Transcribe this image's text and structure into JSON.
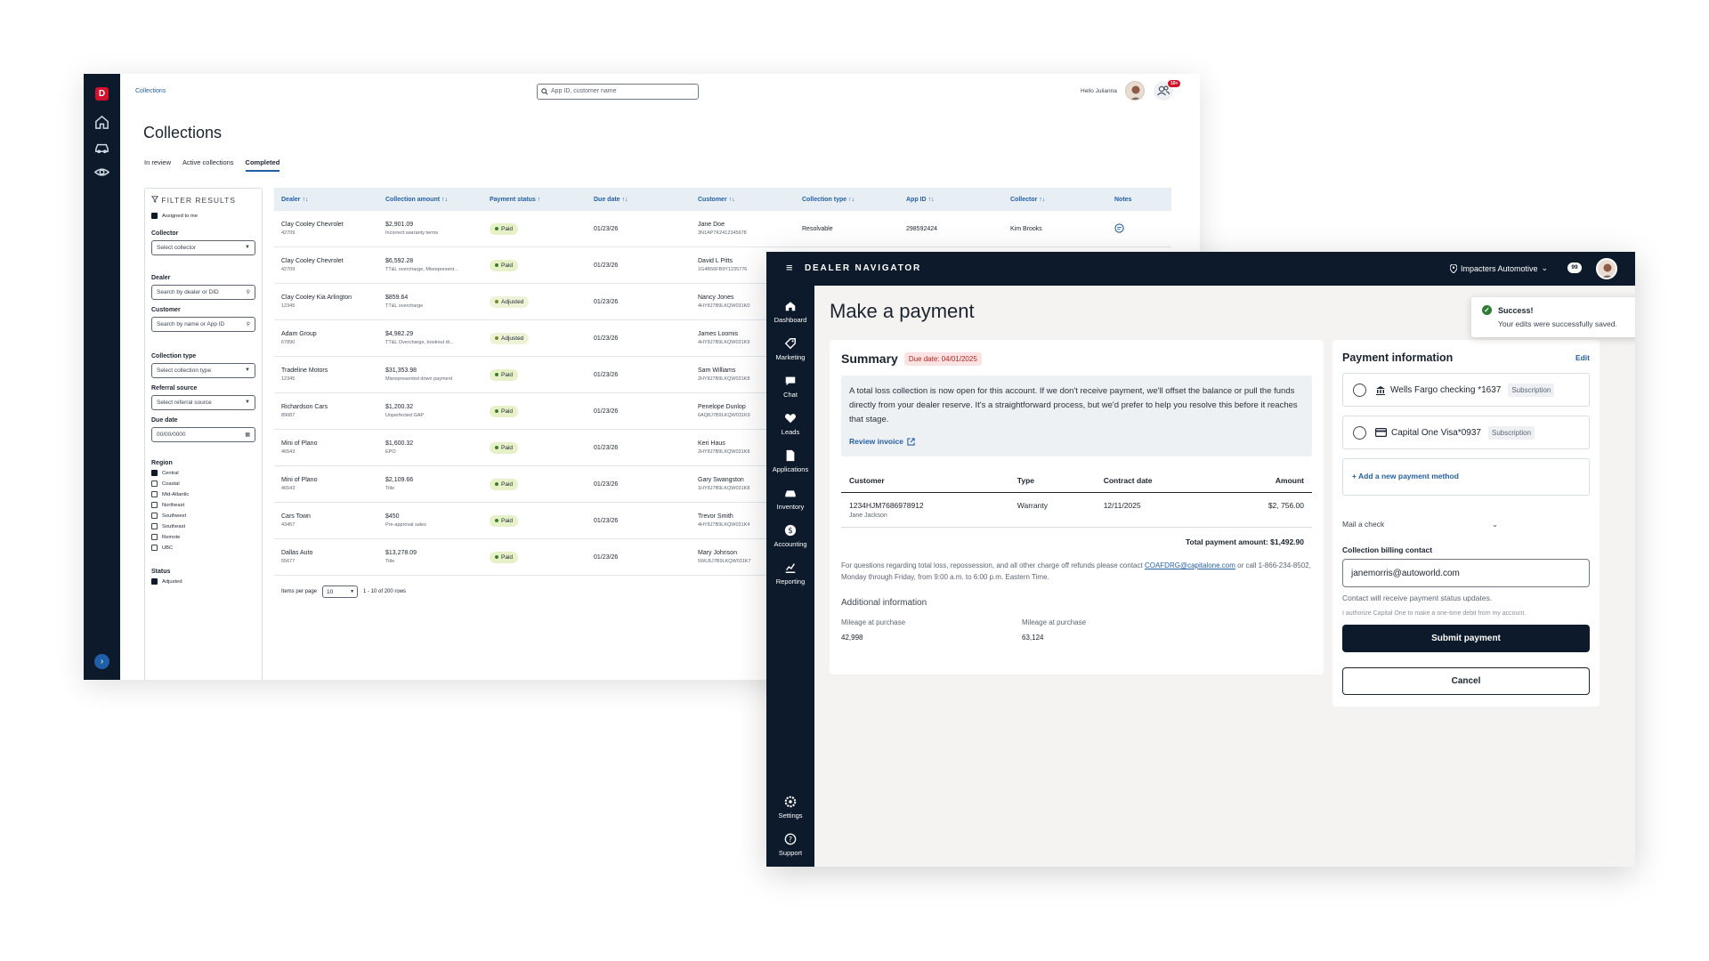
{
  "collections": {
    "breadcrumb": "Collections",
    "search_placeholder": "App ID, customer name",
    "greeting": "Hello Julianna",
    "notif_badge": "10+",
    "title": "Collections",
    "tabs": [
      "In review",
      "Active collections",
      "Completed"
    ],
    "active_tab": "Completed",
    "filter": {
      "header": "FILTER RESULTS",
      "assigned": "Assigned to me",
      "collector_label": "Collector",
      "collector_placeholder": "Select collector",
      "dealer_label": "Dealer",
      "dealer_placeholder": "Search by dealer or DID",
      "customer_label": "Customer",
      "customer_placeholder": "Search by name or App ID",
      "ctype_label": "Collection type",
      "ctype_placeholder": "Select collection type",
      "ref_label": "Referral source",
      "ref_placeholder": "Select referral source",
      "due_label": "Due date",
      "due_placeholder": "00/00/0000",
      "region_label": "Region",
      "regions": [
        {
          "label": "Central",
          "checked": true
        },
        {
          "label": "Coastal",
          "checked": false
        },
        {
          "label": "Mid-Atlantic",
          "checked": false
        },
        {
          "label": "Northeast",
          "checked": false
        },
        {
          "label": "Southwest",
          "checked": false
        },
        {
          "label": "Southeast",
          "checked": false
        },
        {
          "label": "Remote",
          "checked": false
        },
        {
          "label": "UBC",
          "checked": false
        }
      ],
      "status_label": "Status",
      "status_first": "Adjusted"
    },
    "columns": [
      "Dealer ↑↓",
      "Collection amount ↑↓",
      "Payment status ↑",
      "Due date ↑↓",
      "Customer ↑↓",
      "Collection type ↑↓",
      "App ID ↑↓",
      "Collector ↑↓",
      "Notes"
    ],
    "rows": [
      {
        "dealer": "Clay Cooley Chevrolet",
        "did": "42709",
        "amount": "$2,901.09",
        "reason": "Incorrect warranty terms",
        "status": "Paid",
        "due": "01/23/26",
        "customer": "Jane Doe",
        "vin": "3N1AP7K2412345678",
        "ctype": "Resolvable",
        "appid": "298592424",
        "collector": "Kim Brooks",
        "note": true
      },
      {
        "dealer": "Clay Cooley Chevrolet",
        "did": "42709",
        "amount": "$6,592.28",
        "reason": "TT&L overcharge, Misrepresent...",
        "status": "Paid",
        "due": "01/23/26",
        "customer": "David L Pitts",
        "vin": "1G4B56FB9Y1235776",
        "ctype": "",
        "appid": "",
        "collector": "",
        "note": false
      },
      {
        "dealer": "Clay Cooley Kia Arlington",
        "did": "12345",
        "amount": "$859.64",
        "reason": "TT&L overcharge",
        "status": "Adjusted",
        "due": "01/23/26",
        "customer": "Nancy Jones",
        "vin": "4HY8J7B9LKQW031K0",
        "ctype": "",
        "appid": "",
        "collector": "",
        "note": false
      },
      {
        "dealer": "Adam Group",
        "did": "67890",
        "amount": "$4,982.29",
        "reason": "TT&L Overcharge, bookout di...",
        "status": "Adjusted",
        "due": "01/23/26",
        "customer": "James Loomis",
        "vin": "4HY8J7B9LKQW031K9",
        "ctype": "",
        "appid": "",
        "collector": "",
        "note": false
      },
      {
        "dealer": "Tradeline Motors",
        "did": "12345",
        "amount": "$31,353.98",
        "reason": "Misrepresented down payment",
        "status": "Paid",
        "due": "01/23/26",
        "customer": "Sam Williams",
        "vin": "2HY8J7B9LKQW031K8",
        "ctype": "",
        "appid": "",
        "collector": "",
        "note": false
      },
      {
        "dealer": "Richardson Cars",
        "did": "89087",
        "amount": "$1,200.32",
        "reason": "Unperfected GAP",
        "status": "Paid",
        "due": "01/23/26",
        "customer": "Penelope Dunlop",
        "vin": "6AQ8J7B9LKQW031K9",
        "ctype": "",
        "appid": "",
        "collector": "",
        "note": false
      },
      {
        "dealer": "Mini of Plano",
        "did": "46543",
        "amount": "$1,600.32",
        "reason": "EPO",
        "status": "Paid",
        "due": "01/23/26",
        "customer": "Keri Haus",
        "vin": "2HY8J7B9LKQW031K8",
        "ctype": "",
        "appid": "",
        "collector": "",
        "note": false
      },
      {
        "dealer": "Mini of Plano",
        "did": "46543",
        "amount": "$2,109.66",
        "reason": "Title",
        "status": "Paid",
        "due": "01/23/26",
        "customer": "Gary Swangston",
        "vin": "1HY8J7B9LKQW031K8",
        "ctype": "",
        "appid": "",
        "collector": "",
        "note": false
      },
      {
        "dealer": "Cars Town",
        "did": "43457",
        "amount": "$450",
        "reason": "Pre-approval sales",
        "status": "Paid",
        "due": "01/23/26",
        "customer": "Trevor Smith",
        "vin": "4HY8J7B9LKQW031K4",
        "ctype": "",
        "appid": "",
        "collector": "",
        "note": false
      },
      {
        "dealer": "Dallas Auto",
        "did": "55677",
        "amount": "$13,278.09",
        "reason": "Title",
        "status": "Paid",
        "due": "01/23/26",
        "customer": "Mary Johnson",
        "vin": "5WLBJ7B9LKQW031K7",
        "ctype": "",
        "appid": "",
        "collector": "",
        "note": false
      }
    ],
    "pager": {
      "label": "Items per page",
      "value": "10",
      "range": "1 - 10 of 200 rows"
    }
  },
  "navigator": {
    "brand": "DEALER NAVIGATOR",
    "location": "Impacters Automotive",
    "count": "99",
    "nav": [
      "Dashboard",
      "Marketing",
      "Chat",
      "Leads",
      "Applications",
      "Inventory",
      "Accounting",
      "Reporting"
    ],
    "nav_bottom": [
      "Settings",
      "Support"
    ],
    "title": "Make a payment",
    "toast": {
      "title": "Success!",
      "message": "Your edits were successfully saved."
    },
    "summary": {
      "title": "Summary",
      "due": "Due date: 04/01/2025",
      "notice": "A total loss collection is now open for this account. If we don't receive payment, we'll offset the balance or pull the funds directly from your dealer reserve. It's a straightforward process, but we'd prefer to help you resolve this before it reaches that stage.",
      "review": "Review invoice",
      "table_headers": [
        "Customer",
        "Type",
        "Contract date",
        "Amount"
      ],
      "vin": "1234HJM7686978912",
      "customer": "Jane Jackson",
      "type": "Warranty",
      "contract_date": "12/11/2025",
      "amount": "$2, 756.00",
      "total": "Total payment amount: $1,492.90",
      "questions_pre": "For questions regarding total loss, repossession, and all other charge off refunds please contact ",
      "email_link": "COAFDRG@capitalone.com",
      "questions_post": " or call 1-866-234-8502, Monday through Friday, from 9:00 a.m. to 6:00 p.m. Eastern Time.",
      "additional": "Additional information",
      "mileage_label_1": "Mileage at purchase",
      "mileage_value_1": "42,998",
      "mileage_label_2": "Mileage at purchase",
      "mileage_value_2": "63,124"
    },
    "payment": {
      "title": "Payment information",
      "edit": "Edit",
      "method_1": "Wells Fargo checking *1637",
      "method_2": "Capital One Visa*0937",
      "subscription": "Subscription",
      "add": "+ Add a new payment method",
      "mail": "Mail a check",
      "contact_label": "Collection billing contact",
      "email": "janemorris@autoworld.com",
      "hint": "Contact will receive payment status updates.",
      "authorize": "I authorize Capital One to make a one-time debit from my account.",
      "submit": "Submit payment",
      "cancel": "Cancel"
    }
  }
}
